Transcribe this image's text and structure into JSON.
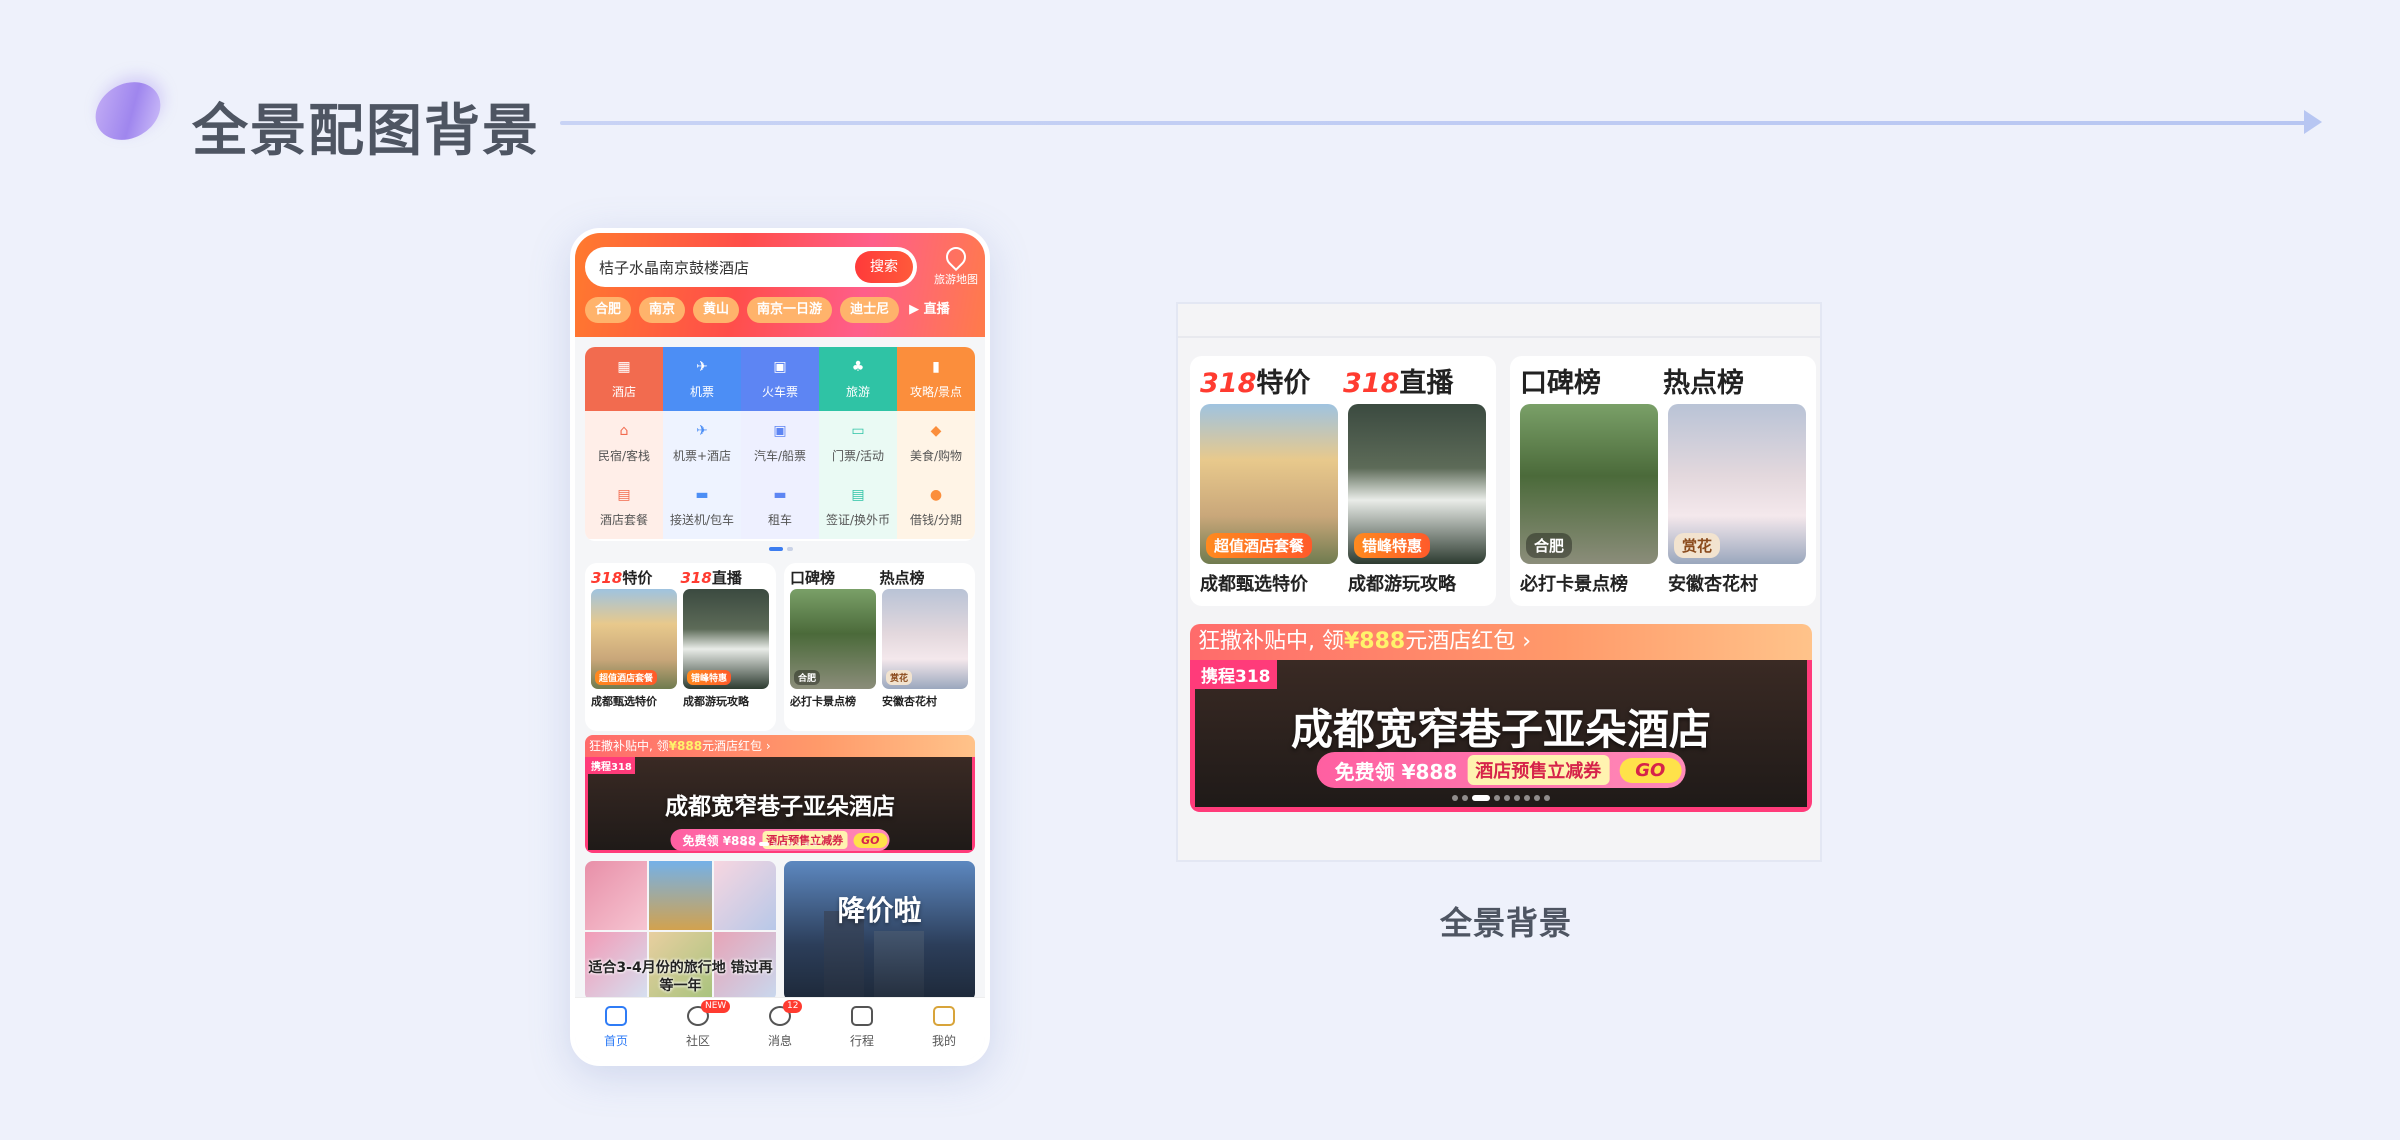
{
  "header": {
    "title": "全景配图背景"
  },
  "phone": {
    "search": {
      "value": "桔子水晶南京鼓楼酒店",
      "button": "搜索",
      "map_label": "旅游地图"
    },
    "chips": [
      "合肥",
      "南京",
      "黄山",
      "南京一日游",
      "迪士尼",
      "▶ 直播"
    ],
    "services": [
      [
        {
          "label": "酒店",
          "icon": "hotel-icon"
        },
        {
          "label": "机票",
          "icon": "plane-icon"
        },
        {
          "label": "火车票",
          "icon": "train-icon"
        },
        {
          "label": "旅游",
          "icon": "palm-tree-icon"
        },
        {
          "label": "攻略/景点",
          "icon": "guidebook-icon"
        }
      ],
      [
        {
          "label": "民宿/客栈",
          "icon": "homestay-icon"
        },
        {
          "label": "机票+酒店",
          "icon": "flight-hotel-icon"
        },
        {
          "label": "汽车/船票",
          "icon": "bus-icon"
        },
        {
          "label": "门票/活动",
          "icon": "ticket-icon"
        },
        {
          "label": "美食/购物",
          "icon": "shopping-bag-icon"
        }
      ],
      [
        {
          "label": "酒店套餐",
          "icon": "hotel-package-icon"
        },
        {
          "label": "接送机/包车",
          "icon": "car-transfer-icon"
        },
        {
          "label": "租车",
          "icon": "car-rental-icon"
        },
        {
          "label": "签证/换外币",
          "icon": "visa-icon"
        },
        {
          "label": "借钱/分期",
          "icon": "money-bag-icon"
        }
      ]
    ],
    "feed": [
      {
        "caption": "适合3-4月份的旅行地 错过再等一年"
      },
      {
        "caption": "降价啦"
      }
    ],
    "tabs": [
      {
        "label": "首页",
        "icon": "home-icon",
        "badge": ""
      },
      {
        "label": "社区",
        "icon": "community-icon",
        "badge": "NEW"
      },
      {
        "label": "消息",
        "icon": "message-icon",
        "badge": "12"
      },
      {
        "label": "行程",
        "icon": "itinerary-icon",
        "badge": ""
      },
      {
        "label": "我的",
        "icon": "profile-icon",
        "badge": ""
      }
    ]
  },
  "promo": {
    "cards": [
      {
        "heads": [
          {
            "num": "318",
            "text": "特价"
          },
          {
            "num": "318",
            "text": "直播"
          }
        ],
        "thumbs": [
          {
            "tag": "超值酒店套餐",
            "caption": "成都甄选特价"
          },
          {
            "tag": "错峰特惠",
            "caption": "成都游玩攻略"
          }
        ]
      },
      {
        "heads": [
          {
            "num": "",
            "text": "口碑榜"
          },
          {
            "num": "",
            "text": "热点榜"
          }
        ],
        "thumbs": [
          {
            "tag": "合肥",
            "caption": "必打卡景点榜"
          },
          {
            "tag": "赏花",
            "caption": "安徽杏花村"
          }
        ]
      }
    ]
  },
  "banner": {
    "top_text": "狂撒补贴中, 领",
    "top_amount": "¥888",
    "top_suffix": "元酒店红包 ›",
    "tagline": "携程318",
    "hotel": "成都宽窄巷子亚朵酒店",
    "coupon": "免费领 ¥888",
    "presale": "酒店预售立减券",
    "go": "GO"
  },
  "pano_caption": "全景背景",
  "colors": {
    "accent": "#ff3b30",
    "brand_blue": "#2f7cf6",
    "page_bg": "#eef1fb"
  }
}
